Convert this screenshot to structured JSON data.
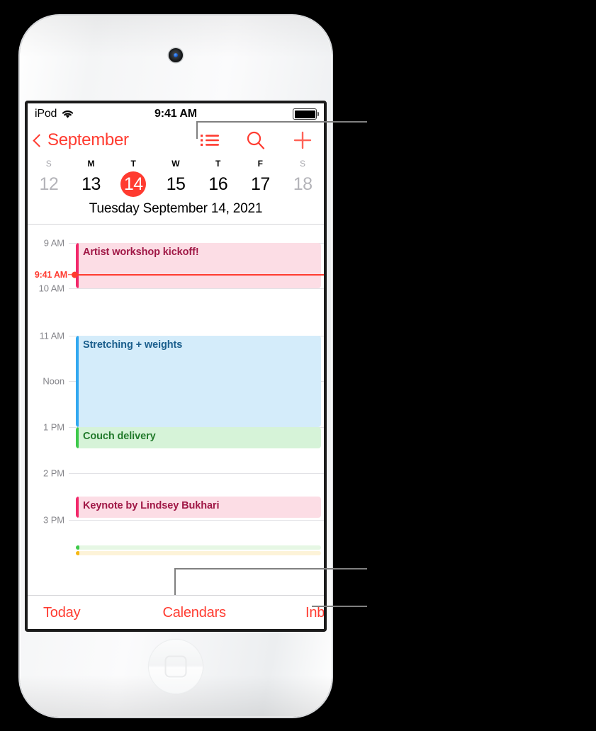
{
  "device": {
    "name": "iPod touch",
    "camera": "front-camera",
    "home_button": "home-button"
  },
  "status_bar": {
    "carrier": "iPod",
    "wifi": "wifi-icon",
    "time": "9:41 AM",
    "battery": "battery-full-icon"
  },
  "nav_bar": {
    "back_label": "September",
    "back_icon": "chevron-left-icon",
    "list_icon": "list-view-icon",
    "search_icon": "search-icon",
    "add_icon": "plus-icon"
  },
  "week_strip": {
    "day_initials": [
      "S",
      "M",
      "T",
      "W",
      "T",
      "F",
      "S"
    ],
    "day_numbers": [
      "12",
      "13",
      "14",
      "15",
      "16",
      "17",
      "18"
    ],
    "dim_days": [
      0,
      6
    ],
    "selected_index": 2,
    "full_date": "Tuesday  September 14, 2021"
  },
  "day_grid": {
    "hour_labels": [
      "9 AM",
      "10 AM",
      "11 AM",
      "Noon",
      "1 PM",
      "2 PM",
      "3 PM"
    ],
    "now_label": "9:41 AM",
    "now_color": "#ff3b30",
    "events": [
      {
        "title": "Artist workshop kickoff!",
        "bar_color": "#f2286a",
        "bg_color": "#fcdde5",
        "text_color": "#a01846",
        "start": "9 AM",
        "end": "10 AM"
      },
      {
        "title": "Stretching + weights",
        "bar_color": "#31a8f0",
        "bg_color": "#d4ecfa",
        "text_color": "#1a5e8c",
        "start": "11 AM",
        "end": "1 PM"
      },
      {
        "title": "Couch delivery",
        "bar_color": "#3dc94a",
        "bg_color": "#d6f3d8",
        "text_color": "#227a2b",
        "start": "1 PM",
        "end": "1:30 PM"
      },
      {
        "title": "Keynote by Lindsey Bukhari",
        "bar_color": "#f2286a",
        "bg_color": "#fcdde5",
        "text_color": "#a01846",
        "start": "2:30 PM",
        "end": "3 PM"
      },
      {
        "title": "",
        "bar_color": "#3dc94a",
        "bg_color": "#e6f7e4",
        "text_color": "#227a2b",
        "start": "4 PM",
        "end": "4 PM"
      },
      {
        "title": "",
        "bar_color": "#f5b814",
        "bg_color": "#fdf3d8",
        "text_color": "#8a6a05",
        "start": "4 PM",
        "end": "4 PM"
      }
    ]
  },
  "toolbar": {
    "today_label": "Today",
    "calendars_label": "Calendars",
    "inbox_label": "Inbox"
  },
  "callouts": {
    "line_color": "#808080",
    "targets": [
      "list-view-icon",
      "calendars-button",
      "inbox-button"
    ]
  }
}
